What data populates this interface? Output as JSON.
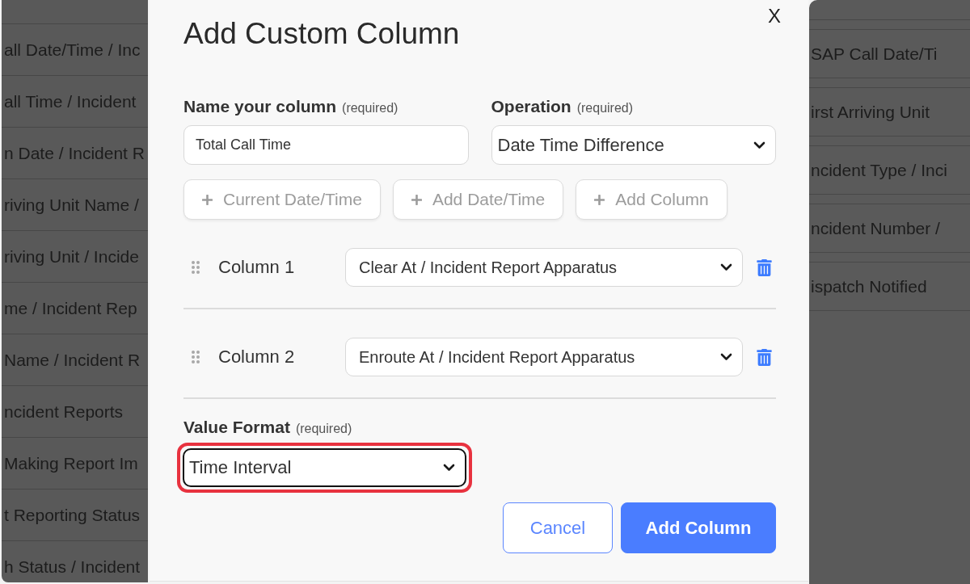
{
  "background_left": {
    "rows": [
      "all Date/Time / Inc",
      "all Time / Incident",
      "n Date / Incident R",
      "riving Unit Name /",
      "riving Unit / Incide",
      "me / Incident Rep",
      "Name / Incident R",
      "ncident Reports",
      "Making Report Im",
      "t Reporting Status",
      "h Status / Incident"
    ]
  },
  "background_right": {
    "rows": [
      "SAP Call Date/Ti",
      "irst Arriving Unit",
      "ncident Type / Inci",
      "ncident Number /",
      "ispatch Notified"
    ]
  },
  "dialog": {
    "title": "Add Custom Column",
    "close": "X",
    "name_field": {
      "label": "Name your column",
      "hint": "(required)",
      "value": "Total Call Time"
    },
    "operation": {
      "label": "Operation",
      "hint": "(required)",
      "value": "Date Time Difference"
    },
    "insert_buttons": [
      {
        "label": "Current Date/Time",
        "disabled": true
      },
      {
        "label": "Add Date/Time",
        "disabled": true
      },
      {
        "label": "Add Column",
        "disabled": true
      }
    ],
    "columns": [
      {
        "label": "Column 1",
        "value": "Clear At / Incident Report Apparatus"
      },
      {
        "label": "Column 2",
        "value": "Enroute At / Incident Report Apparatus"
      }
    ],
    "value_format": {
      "label": "Value Format",
      "hint": "(required)",
      "value": "Time Interval",
      "focused": true,
      "highlighted": true
    },
    "buttons": [
      {
        "label": "Cancel",
        "kind": "secondary"
      },
      {
        "label": "Add Column",
        "kind": "primary"
      }
    ]
  }
}
